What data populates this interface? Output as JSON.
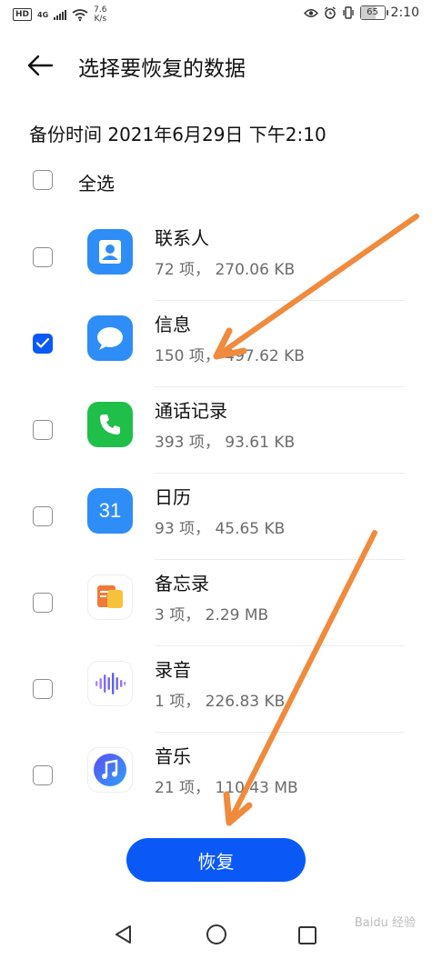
{
  "status_bar": {
    "hd": "HD",
    "network": "4G",
    "speed_value": "7.6",
    "speed_unit": "K/s",
    "battery": "65",
    "battery_level": 0.65,
    "time": "2:10"
  },
  "header": {
    "title": "选择要恢复的数据"
  },
  "backup_time": "备份时间 2021年6月29日 下午2:10",
  "select_all": {
    "label": "全选",
    "checked": false
  },
  "items": [
    {
      "name": "联系人",
      "meta": "72 项， 270.06 KB",
      "checked": false,
      "icon": "contacts-icon",
      "color": "#2e8df7"
    },
    {
      "name": "信息",
      "meta": "150 项， 497.62 KB",
      "checked": true,
      "icon": "messages-icon",
      "color": "#2e8df7"
    },
    {
      "name": "通话记录",
      "meta": "393 项， 93.61 KB",
      "checked": false,
      "icon": "phone-icon",
      "color": "#1fbf4a"
    },
    {
      "name": "日历",
      "meta": "93 项， 45.65 KB",
      "checked": false,
      "icon": "calendar-icon",
      "icon_text": "31",
      "color": "#2e8df7"
    },
    {
      "name": "备忘录",
      "meta": "3 项， 2.29 MB",
      "checked": false,
      "icon": "notes-icon",
      "color": "#f5a623"
    },
    {
      "name": "录音",
      "meta": "1 项， 226.83 KB",
      "checked": false,
      "icon": "recorder-icon",
      "color": "#7a5cf0"
    },
    {
      "name": "音乐",
      "meta": "21 项， 110.43 MB",
      "checked": false,
      "icon": "music-icon",
      "color": "#3f6cf5"
    }
  ],
  "restore_button": "恢复",
  "watermark": "Baidu 经验",
  "colors": {
    "accent": "#0a59f7",
    "annotation_arrow": "#f08a3c"
  }
}
